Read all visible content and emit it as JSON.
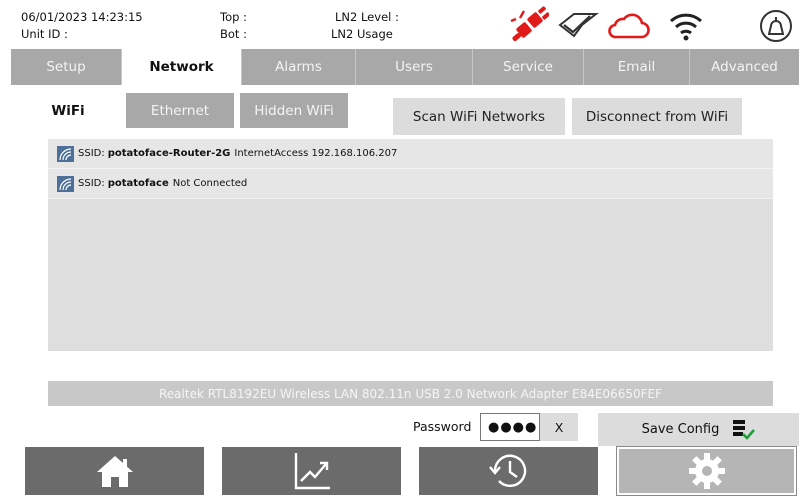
{
  "header": {
    "datetime": "06/01/2023 14:23:15",
    "unit_id_label": "Unit ID :",
    "top_label": "Top :",
    "bot_label": "Bot :",
    "ln2_level_label": "LN2 Level :",
    "ln2_usage_label": "LN2 Usage",
    "icons": [
      "power-disconnected-icon",
      "check-diamond-icon",
      "cloud-icon",
      "wifi-icon",
      "lid-icon"
    ],
    "colors": {
      "alert": "#e11a1a",
      "icon": "#333333"
    }
  },
  "tabs": [
    {
      "label": "Setup",
      "active": false
    },
    {
      "label": "Network",
      "active": true
    },
    {
      "label": "Alarms",
      "active": false
    },
    {
      "label": "Users",
      "active": false
    },
    {
      "label": "Service",
      "active": false
    },
    {
      "label": "Email",
      "active": false
    },
    {
      "label": "Advanced",
      "active": false
    }
  ],
  "subtabs": [
    {
      "label": "WiFi",
      "active": true
    },
    {
      "label": "Ethernet",
      "active": false
    },
    {
      "label": "Hidden WiFi",
      "active": false
    }
  ],
  "actions": {
    "scan": "Scan WiFi Networks",
    "disconnect": "Disconnect from WiFi"
  },
  "networks": [
    {
      "ssid_prefix": "SSID:",
      "ssid": "potatoface-Router-2G",
      "status": "InternetAccess 192.168.106.207"
    },
    {
      "ssid_prefix": "SSID:",
      "ssid": "potatoface",
      "status": "Not Connected"
    }
  ],
  "adapter": "Realtek RTL8192EU Wireless LAN 802.11n USB 2.0 Network Adapter E84E06650FEF",
  "password": {
    "label": "Password",
    "masked_value": "●●●●",
    "clear_label": "X"
  },
  "save_config": "Save Config",
  "bottom_nav": [
    {
      "icon": "home-icon",
      "active": false
    },
    {
      "icon": "trend-chart-icon",
      "active": false
    },
    {
      "icon": "history-clock-icon",
      "active": false
    },
    {
      "icon": "settings-gear-icon",
      "active": true
    }
  ]
}
